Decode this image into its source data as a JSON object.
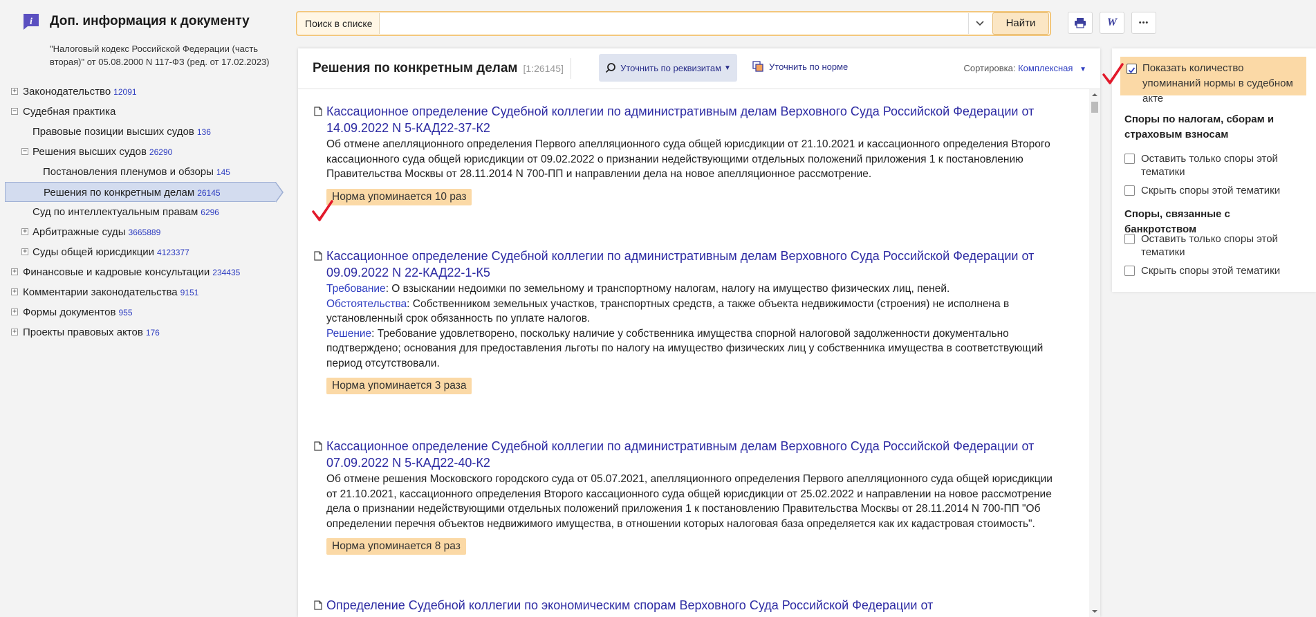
{
  "app": {
    "title": "Доп. информация к документу",
    "doc_caption": "\"Налоговый кодекс Российской Федерации (часть вторая)\" от 05.08.2000 N 117-ФЗ (ред. от 17.02.2023)"
  },
  "tree": [
    {
      "label": "Законодательство",
      "count": "12091",
      "level": 0,
      "toggle": "+"
    },
    {
      "label": "Судебная практика",
      "count": "",
      "level": 0,
      "toggle": "−"
    },
    {
      "label": "Правовые позиции высших судов",
      "count": "136",
      "level": 1,
      "toggle": ""
    },
    {
      "label": "Решения высших судов",
      "count": "26290",
      "level": 1,
      "toggle": "−"
    },
    {
      "label": "Постановления пленумов и обзоры",
      "count": "145",
      "level": 2,
      "toggle": ""
    },
    {
      "label": "Решения по конкретным делам",
      "count": "26145",
      "level": 2,
      "toggle": "",
      "selected": true
    },
    {
      "label": "Суд по интеллектуальным правам",
      "count": "6296",
      "level": 1,
      "toggle": ""
    },
    {
      "label": "Арбитражные суды",
      "count": "3665889",
      "level": 1,
      "toggle": "+"
    },
    {
      "label": "Суды общей юрисдикции",
      "count": "4123377",
      "level": 1,
      "toggle": "+"
    },
    {
      "label": "Финансовые и кадровые консультации",
      "count": "234435",
      "level": 0,
      "toggle": "+"
    },
    {
      "label": "Комментарии законодательства",
      "count": "9151",
      "level": 0,
      "toggle": "+"
    },
    {
      "label": "Формы документов",
      "count": "955",
      "level": 0,
      "toggle": "+"
    },
    {
      "label": "Проекты правовых актов",
      "count": "176",
      "level": 0,
      "toggle": "+"
    }
  ],
  "search": {
    "scope_label": "Поиск в списке",
    "value": "",
    "placeholder": "",
    "button_label": "Найти"
  },
  "toolbar": {
    "print_icon": "printer-icon",
    "word_label": "W",
    "more_label": "•••"
  },
  "panel": {
    "title": "Решения по конкретным делам",
    "count": "[1:26145]",
    "refine_label": "Уточнить по реквизитам",
    "norm_label": "Уточнить по норме",
    "sort_label": "Сортировка:",
    "sort_value": "Комплексная"
  },
  "results": [
    {
      "title": "Кассационное определение Судебной коллегии по административным делам Верховного Суда Российской Федерации от 14.09.2022 N 5-КАД22-37-К2",
      "text": "Об отмене апелляционного определения Первого апелляционного суда общей юрисдикции от 21.10.2021 и кассационного определения Второго кассационного суда общей юрисдикции от 09.02.2022 о признании недействующими отдельных положений приложения 1 к постановлению Правительства Москвы от 28.11.2014 N 700-ПП и направлении дела на новое апелляционное рассмотрение.",
      "badge": "Норма упоминается 10 раз"
    },
    {
      "title": "Кассационное определение Судебной коллегии по административным делам Верховного Суда Российской Федерации от 09.09.2022 N 22-КАД22-1-К5",
      "req_label": "Требование",
      "req_text": ": О взыскании недоимки по земельному и транспортному налогам, налогу на имущество физических лиц, пеней.",
      "circ_label": "Обстоятельства",
      "circ_text": ": Собственником земельных участков, транспортных средств, а также объекта недвижимости (строения) не исполнена в установленный срок обязанность по уплате налогов.",
      "dec_label": "Решение",
      "dec_text": ": Требование удовлетворено, поскольку наличие у собственника имущества спорной налоговой задолженности документально подтверждено; основания для предоставления льготы по налогу на имущество физических лиц у собственника имущества в соответствующий период отсутствовали.",
      "badge": "Норма упоминается 3 раза"
    },
    {
      "title": "Кассационное определение Судебной коллегии по административным делам Верховного Суда Российской Федерации от 07.09.2022 N 5-КАД22-40-К2",
      "text": "Об отмене решения Московского городского суда от 05.07.2021, апелляционного определения Первого апелляционного суда общей юрисдикции от 21.10.2021, кассационного определения Второго кассационного суда общей юрисдикции от 25.02.2022 и направлении на новое рассмотрение дела о признании недействующими отдельных положений приложения 1 к постановлению Правительства Москвы от 28.11.2014 N 700-ПП \"Об определении перечня объектов недвижимого имущества, в отношении которых налоговая база определяется как их кадастровая стоимость\".",
      "badge": "Норма упоминается 8 раз"
    },
    {
      "title": "Определение Судебной коллегии по экономическим спорам Верховного Суда Российской Федерации от"
    }
  ],
  "filters": {
    "show_count_label": "Показать количество упоминаний нормы в судебном акте",
    "show_count_checked": true,
    "groups": [
      {
        "title": "Споры по налогам, сборам и страховым взносам",
        "options": [
          "Оставить только споры этой тематики",
          "Скрыть споры этой тематики"
        ]
      },
      {
        "title": "Споры, связанные с банкротством",
        "options": [
          "Оставить только споры этой тематики",
          "Скрыть споры этой тематики"
        ]
      }
    ]
  },
  "colors": {
    "accent_link": "#2d2ba3",
    "badge_bg": "#fbd9a6",
    "search_border": "#f3c77c",
    "selected_bg": "#d3dcef",
    "annotation_red": "#e2192b"
  }
}
